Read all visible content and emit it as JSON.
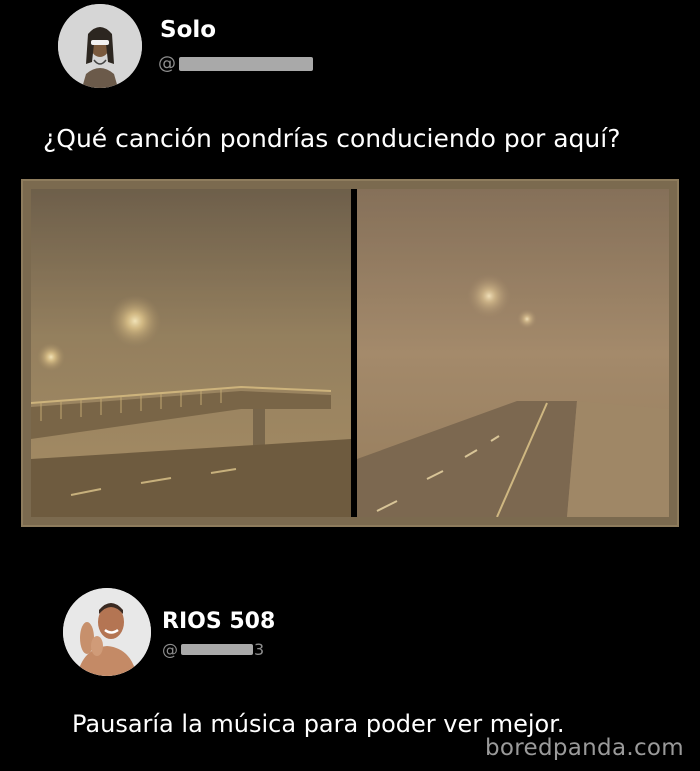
{
  "post1": {
    "author": {
      "display_name": "Solo",
      "handle_prefix": "@"
    },
    "text": "¿Qué canción pondrías conduciendo por aquí?",
    "media": {
      "description": "two-panel photo"
    }
  },
  "post2": {
    "author": {
      "display_name": "RIOS 508",
      "handle_prefix": "@",
      "handle_tail": "3"
    },
    "text": "Pausaría la música para poder ver mejor."
  },
  "watermark": "boredpanda.com",
  "colors": {
    "background": "#000000",
    "handle": "#8e8e8e",
    "frame": "#8e7c5d"
  }
}
